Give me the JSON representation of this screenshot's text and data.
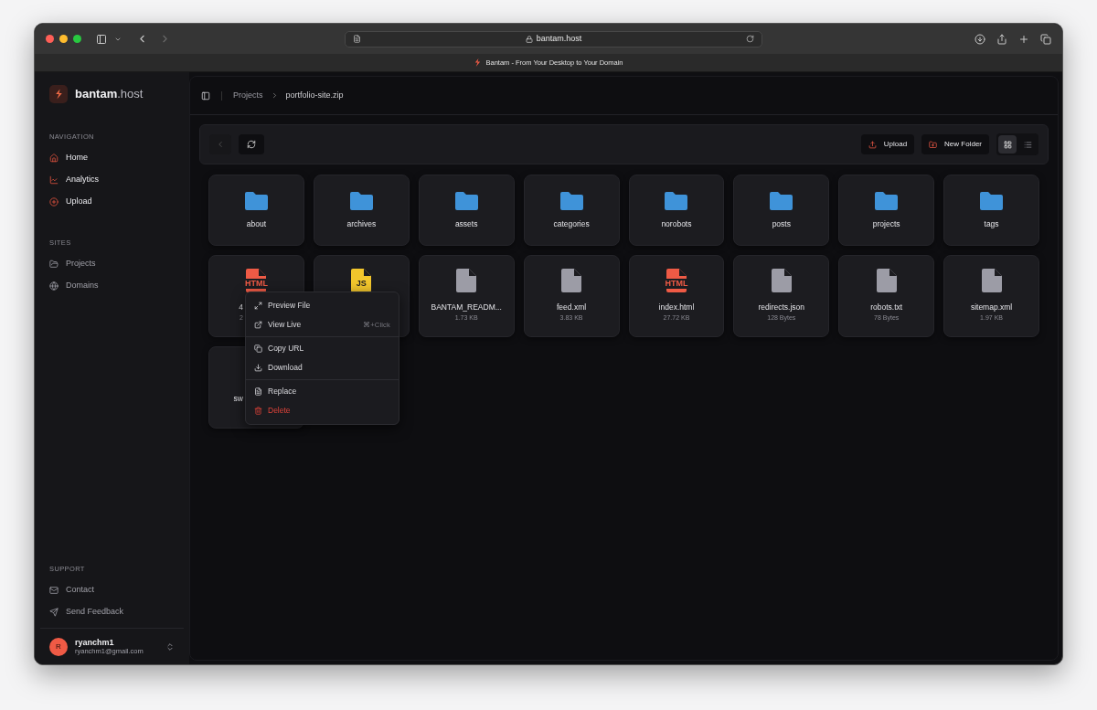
{
  "browser": {
    "address": "bantam.host",
    "tab_title": "Bantam - From Your Desktop to Your Domain"
  },
  "sidebar": {
    "brand": "bantam",
    "brand_suffix": ".host",
    "sections": [
      {
        "title": "NAVIGATION",
        "items": [
          {
            "label": "Home"
          },
          {
            "label": "Analytics"
          },
          {
            "label": "Upload"
          }
        ]
      },
      {
        "title": "SITES",
        "items": [
          {
            "label": "Projects"
          },
          {
            "label": "Domains"
          }
        ]
      }
    ],
    "support": {
      "title": "SUPPORT",
      "items": [
        {
          "label": "Contact"
        },
        {
          "label": "Send Feedback"
        }
      ]
    },
    "user": {
      "initial": "R",
      "name": "ryanchm1",
      "email": "ryanchm1@gmail.com"
    }
  },
  "breadcrumb": [
    "Projects",
    "portfolio-site.zip"
  ],
  "toolbar": {
    "upload": "Upload",
    "new_folder": "New Folder",
    "view": [
      {
        "kind": "grid",
        "selected": true
      },
      {
        "kind": "list",
        "selected": false
      }
    ]
  },
  "items": [
    {
      "kind": "folder",
      "name": "about"
    },
    {
      "kind": "folder",
      "name": "archives"
    },
    {
      "kind": "folder",
      "name": "assets"
    },
    {
      "kind": "folder",
      "name": "categories"
    },
    {
      "kind": "folder",
      "name": "norobots"
    },
    {
      "kind": "folder",
      "name": "posts"
    },
    {
      "kind": "folder",
      "name": "projects"
    },
    {
      "kind": "folder",
      "name": "tags"
    },
    {
      "kind": "html",
      "icon_label": "HTML",
      "name": "4",
      "size": "2",
      "cut": true
    },
    {
      "kind": "js",
      "icon_label": "JS"
    },
    {
      "kind": "file",
      "name": "BANTAM_READM...",
      "size": "1.73 KB"
    },
    {
      "kind": "file",
      "name": "feed.xml",
      "size": "3.83 KB"
    },
    {
      "kind": "html",
      "icon_label": "HTML",
      "name": "index.html",
      "size": "27.72 KB"
    },
    {
      "kind": "file",
      "name": "redirects.json",
      "size": "128 Bytes"
    },
    {
      "kind": "file",
      "name": "robots.txt",
      "size": "78 Bytes"
    },
    {
      "kind": "file",
      "name": "sitemap.xml",
      "size": "1.97 KB"
    },
    {
      "name": "sw",
      "cut": true
    }
  ],
  "context_menu": [
    [
      {
        "label": "Preview File",
        "danger": false
      },
      {
        "label": "View Live",
        "shortcut": "⌘+Click",
        "danger": false
      }
    ],
    [
      {
        "label": "Copy URL",
        "danger": false
      },
      {
        "label": "Download",
        "danger": false
      }
    ],
    [
      {
        "label": "Replace",
        "danger": false
      },
      {
        "label": "Delete",
        "danger": true
      }
    ]
  ]
}
